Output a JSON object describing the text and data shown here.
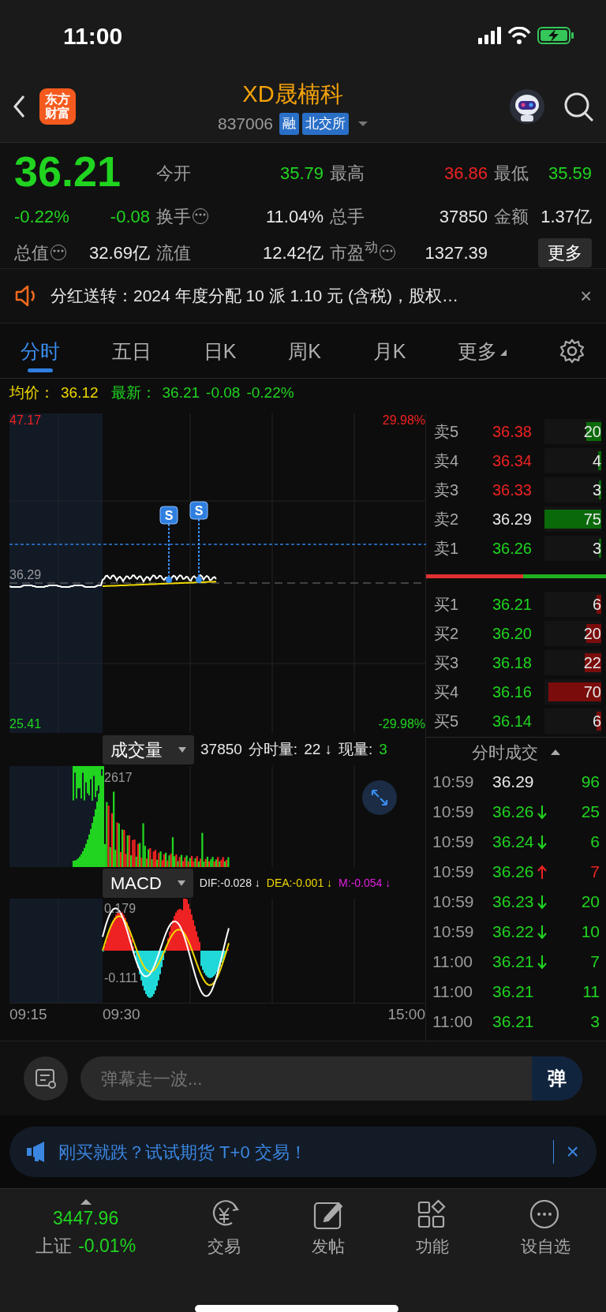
{
  "status_bar": {
    "time": "11:00"
  },
  "header": {
    "logo": "东方财富",
    "title": "XD晟楠科",
    "code": "837006",
    "badges": [
      "融",
      "北交所"
    ]
  },
  "quote": {
    "price": "36.21",
    "change_pct": "-0.22%",
    "change": "-0.08",
    "color": "#20d420",
    "stats": [
      {
        "label": "今开",
        "value": "35.79",
        "color": "#20d420",
        "info": false
      },
      {
        "label": "最高",
        "value": "36.86",
        "color": "#ee2222",
        "info": false
      },
      {
        "label": "最低",
        "value": "35.59",
        "color": "#20d420",
        "info": false
      },
      {
        "label": "换手",
        "value": "11.04%",
        "color": "#e8e8e8",
        "info": true
      },
      {
        "label": "总手",
        "value": "37850",
        "color": "#e8e8e8",
        "info": false
      },
      {
        "label": "金额",
        "value": "1.37亿",
        "color": "#e8e8e8",
        "info": false
      },
      {
        "label": "总值",
        "value": "32.69亿",
        "color": "#e8e8e8",
        "info": true
      },
      {
        "label": "流值",
        "value": "12.42亿",
        "color": "#e8e8e8",
        "info": false
      },
      {
        "label": "市盈$^{动}$",
        "value": "1327.39",
        "color": "#e8e8e8",
        "info": true
      }
    ],
    "more_button": "更多"
  },
  "notice": {
    "text": "分红送转：2024 年度分配 10 派 1.10 元 (含税)，股权…",
    "close": "×"
  },
  "tabs": [
    {
      "label": "分时",
      "selected": true,
      "dropdown": false
    },
    {
      "label": "五日",
      "selected": false,
      "dropdown": false
    },
    {
      "label": "日K",
      "selected": false,
      "dropdown": false
    },
    {
      "label": "周K",
      "selected": false,
      "dropdown": false
    },
    {
      "label": "月K",
      "selected": false,
      "dropdown": false
    },
    {
      "label": "更多",
      "selected": false,
      "dropdown": true
    }
  ],
  "summary": {
    "avg_label": "均价：",
    "avg": "36.12",
    "latest_label": "最新：",
    "latest": "36.21",
    "change": "-0.08",
    "change_pct": "-0.22%"
  },
  "price_chart": {
    "ymax": "47.17",
    "ymax_pct": "29.98%",
    "prev_close": "36.29",
    "ymin": "25.41",
    "ymin_pct": "-29.98%",
    "markers": [
      "S",
      "S"
    ]
  },
  "order_book": {
    "asks": [
      {
        "label": "卖5",
        "price": "36.38",
        "volume": "20",
        "color": "#ee2222",
        "level": 0.27
      },
      {
        "label": "卖4",
        "price": "36.34",
        "volume": "4",
        "color": "#ee2222",
        "level": 0.05
      },
      {
        "label": "卖3",
        "price": "36.33",
        "volume": "3",
        "color": "#ee2222",
        "level": 0.04
      },
      {
        "label": "卖2",
        "price": "36.29",
        "volume": "75",
        "color": "#e8e8e8",
        "level": 1.0
      },
      {
        "label": "卖1",
        "price": "36.26",
        "volume": "3",
        "color": "#20d420",
        "level": 0.04
      }
    ],
    "ratio": {
      "level": 0.54
    },
    "bids": [
      {
        "label": "买1",
        "price": "36.21",
        "volume": "6",
        "color": "#20d420",
        "level": 0.08
      },
      {
        "label": "买2",
        "price": "36.20",
        "volume": "20",
        "color": "#20d420",
        "level": 0.27
      },
      {
        "label": "买3",
        "price": "36.18",
        "volume": "22",
        "color": "#20d420",
        "level": 0.29
      },
      {
        "label": "买4",
        "price": "36.16",
        "volume": "70",
        "color": "#20d420",
        "level": 0.93
      },
      {
        "label": "买5",
        "price": "36.14",
        "volume": "6",
        "color": "#20d420",
        "level": 0.08
      }
    ]
  },
  "volume": {
    "selector": "成交量",
    "total": "37850",
    "label": "分时量:",
    "value": "22",
    "arrow": "↓",
    "now_label": "现量:",
    "now": "3",
    "max": "2617"
  },
  "macd": {
    "selector": "MACD",
    "dif": "DIF:-0.028 ↓",
    "dea": "DEA:-0.001 ↓",
    "m": "M:-0.054 ↓",
    "max": "0.179",
    "min": "-0.111"
  },
  "time_axis": [
    "09:15",
    "09:30",
    "15:00"
  ],
  "trades": {
    "title": "分时成交",
    "rows": [
      {
        "time": "10:59",
        "price": "36.29",
        "color": "#e8e8e8",
        "volume": "96",
        "kind": "none"
      },
      {
        "time": "10:59",
        "price": "36.26",
        "color": "#20d420",
        "volume": "25",
        "kind": "down"
      },
      {
        "time": "10:59",
        "price": "36.24",
        "color": "#20d420",
        "volume": "6",
        "kind": "down"
      },
      {
        "time": "10:59",
        "price": "36.26",
        "color": "#20d420",
        "volume": "7",
        "kind": "up"
      },
      {
        "time": "10:59",
        "price": "36.23",
        "color": "#20d420",
        "volume": "20",
        "kind": "down"
      },
      {
        "time": "10:59",
        "price": "36.22",
        "color": "#20d420",
        "volume": "10",
        "kind": "down"
      },
      {
        "time": "11:00",
        "price": "36.21",
        "color": "#20d420",
        "volume": "7",
        "kind": "down"
      },
      {
        "time": "11:00",
        "price": "36.21",
        "color": "#20d420",
        "volume": "11",
        "kind": "none"
      },
      {
        "time": "11:00",
        "price": "36.21",
        "color": "#20d420",
        "volume": "3",
        "kind": "none"
      }
    ]
  },
  "danmu": {
    "placeholder": "弹幕走一波...",
    "send": "弹"
  },
  "ad": {
    "text": "刚买就跌？试试期货 T+0 交易！",
    "close": "×"
  },
  "bottom_nav": {
    "index": {
      "value": "3447.96",
      "name": "上证",
      "change": "-0.01%"
    },
    "items": [
      {
        "label": "交易",
        "kind": "trade"
      },
      {
        "label": "发帖",
        "kind": "post"
      },
      {
        "label": "功能",
        "kind": "apps"
      },
      {
        "label": "设自选",
        "kind": "more"
      }
    ]
  }
}
